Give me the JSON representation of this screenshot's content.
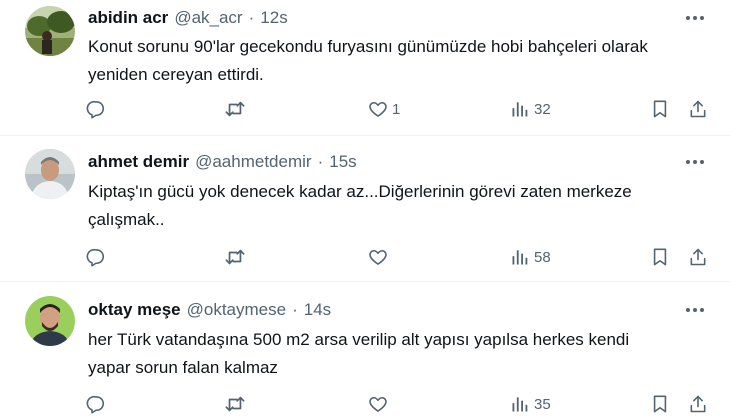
{
  "tweets": [
    {
      "name": "abidin acr",
      "handle": "@ak_acr",
      "separator": "·",
      "time": "12s",
      "text_lines": [
        "Konut sorunu 90'lar gecekondu furyasını günümüzde hobi bahçeleri olarak",
        "yeniden cereyan ettirdi."
      ],
      "replies": "",
      "retweets": "",
      "likes": "1",
      "views": "32"
    },
    {
      "name": "ahmet demir",
      "handle": "@aahmetdemir",
      "separator": "·",
      "time": "15s",
      "text_lines": [
        "Kiptaş'ın gücü yok denecek kadar az...Diğerlerinin görevi zaten merkeze",
        "çalışmak.."
      ],
      "replies": "",
      "retweets": "",
      "likes": "",
      "views": "58"
    },
    {
      "name": "oktay meşe",
      "handle": "@oktaymese",
      "separator": "·",
      "time": "14s",
      "text_lines": [
        "her Türk vatandaşına 500 m2 arsa verilip alt yapısı yapılsa herkes kendi",
        "yapar sorun falan kalmaz"
      ],
      "replies": "",
      "retweets": "",
      "likes": "",
      "views": "35"
    }
  ],
  "icons": {
    "reply": "reply-icon",
    "retweet": "retweet-icon",
    "like": "heart-icon",
    "views": "views-icon",
    "bookmark": "bookmark-icon",
    "share": "share-icon",
    "more": "more-icon"
  },
  "colors": {
    "text": "#0f1419",
    "secondary": "#536471",
    "divider": "#eff3f4"
  }
}
